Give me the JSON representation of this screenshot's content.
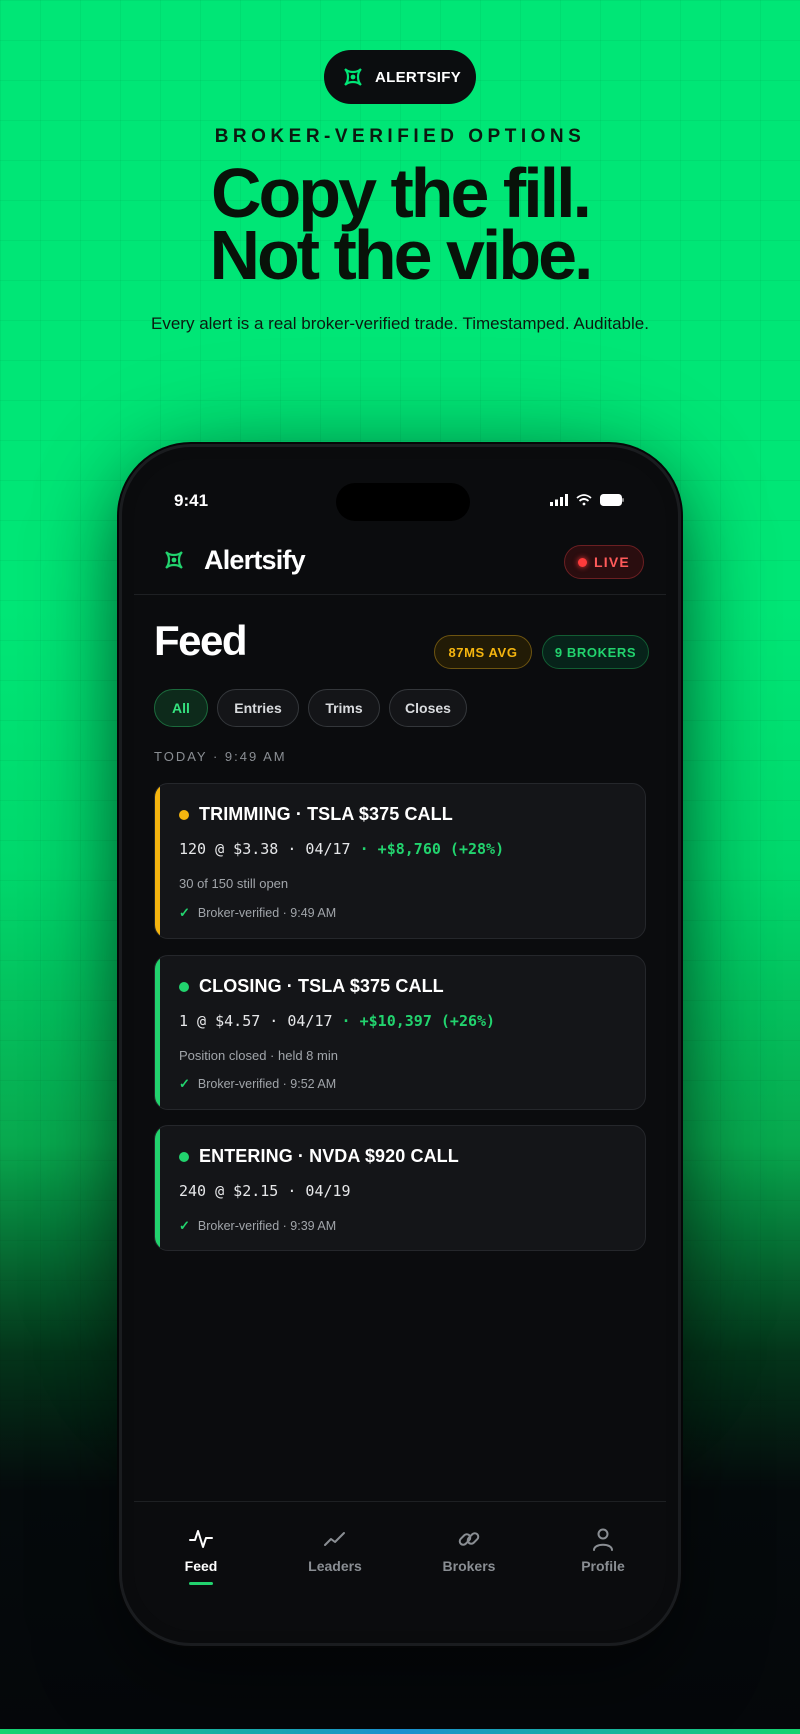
{
  "brand": {
    "badge_label": "ALERTSIFY",
    "app_name": "Alertsify",
    "accent": "#00e676"
  },
  "hero": {
    "eyebrow": "BROKER-VERIFIED OPTIONS",
    "headline_line1": "Copy the fill.",
    "headline_line2": "Not the vibe.",
    "subhead": "Every alert is a real broker-verified trade. Timestamped. Auditable."
  },
  "status_bar": {
    "time": "9:41",
    "icons": [
      "signal-icon",
      "wifi-icon",
      "battery-icon"
    ]
  },
  "header": {
    "live_label": "LIVE"
  },
  "feed": {
    "title": "Feed",
    "latency_badge": "87MS AVG",
    "brokers_badge": "9 BROKERS",
    "filters": [
      {
        "label": "All",
        "active": true
      },
      {
        "label": "Entries",
        "active": false
      },
      {
        "label": "Trims",
        "active": false
      },
      {
        "label": "Closes",
        "active": false
      }
    ],
    "section_label": "TODAY · 9:49 AM",
    "cards": [
      {
        "color": "#f5b50f",
        "title": "TRIMMING · TSLA $375 CALL",
        "trade": "120 @ $3.38 · 04/17",
        "pnl": " · +$8,760 (+28%)",
        "note": "30 of 150 still open",
        "verified": "Broker-verified · 9:49 AM"
      },
      {
        "color": "#22d36e",
        "title": "CLOSING · TSLA $375 CALL",
        "trade": "1 @ $4.57 · 04/17",
        "pnl": " · +$10,397 (+26%)",
        "note": "Position closed · held 8 min",
        "verified": "Broker-verified · 9:52 AM"
      },
      {
        "color": "#22d36e",
        "title": "ENTERING · NVDA $920 CALL",
        "trade": "240 @ $2.15 · 04/19",
        "pnl": "",
        "note": "",
        "verified": "Broker-verified · 9:39 AM"
      }
    ]
  },
  "tabbar": {
    "tabs": [
      {
        "label": "Feed",
        "icon": "activity-icon",
        "active": true
      },
      {
        "label": "Leaders",
        "icon": "trend-icon",
        "active": false
      },
      {
        "label": "Brokers",
        "icon": "link-icon",
        "active": false
      },
      {
        "label": "Profile",
        "icon": "user-icon",
        "active": false
      }
    ]
  }
}
